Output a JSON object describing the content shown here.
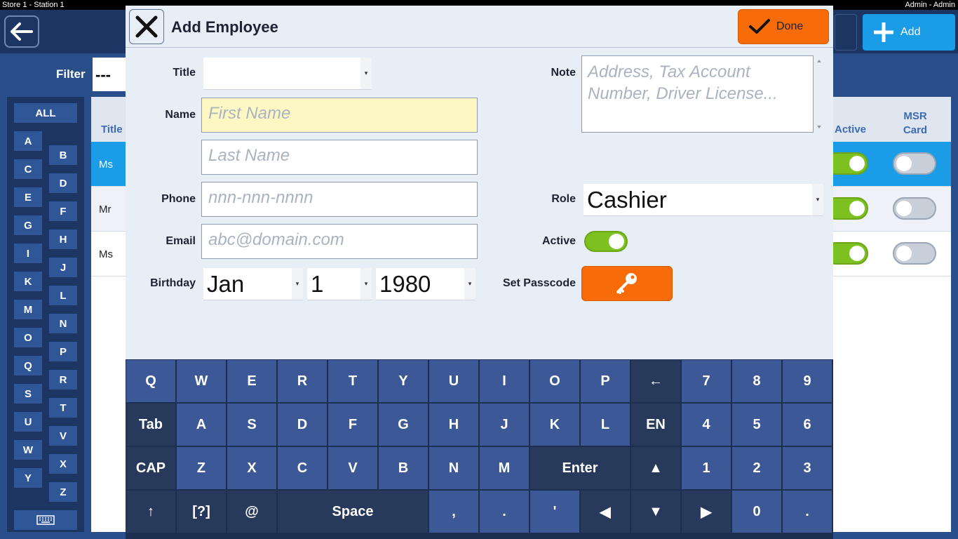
{
  "window": {
    "station": "Store 1 - Station 1",
    "user": "Admin - Admin"
  },
  "toolbar": {
    "add_label": "Add"
  },
  "filter": {
    "label": "Filter",
    "value": "---"
  },
  "alphabet": {
    "all_label": "ALL",
    "left_column": [
      "A",
      "C",
      "E",
      "G",
      "I",
      "K",
      "M",
      "O",
      "Q",
      "S",
      "U",
      "W",
      "Y"
    ],
    "right_column": [
      "B",
      "D",
      "F",
      "H",
      "J",
      "L",
      "N",
      "P",
      "R",
      "T",
      "V",
      "X",
      "Z"
    ]
  },
  "list": {
    "columns": {
      "title": "Title",
      "active": "Active",
      "msr_card": "MSR Card"
    },
    "rows": [
      {
        "title": "Ms",
        "active": true,
        "msr_card": false
      },
      {
        "title": "Mr",
        "active": true,
        "msr_card": false
      },
      {
        "title": "Ms",
        "active": true,
        "msr_card": false
      }
    ]
  },
  "dialog": {
    "title": "Add Employee",
    "done_label": "Done",
    "fields": {
      "title_label": "Title",
      "title_value": "",
      "name_label": "Name",
      "first_name_placeholder": "First Name",
      "last_name_placeholder": "Last Name",
      "phone_label": "Phone",
      "phone_placeholder": "nnn-nnn-nnnn",
      "email_label": "Email",
      "email_placeholder": "abc@domain.com",
      "birthday_label": "Birthday",
      "birthday_month": "Jan",
      "birthday_day": "1",
      "birthday_year": "1980",
      "note_label": "Note",
      "note_placeholder": "Address, Tax Account Number, Driver License...",
      "role_label": "Role",
      "role_value": "Cashier",
      "active_label": "Active",
      "active_on": true,
      "passcode_label": "Set Passcode"
    }
  },
  "keyboard": {
    "rows": [
      [
        "Q",
        "W",
        "E",
        "R",
        "T",
        "Y",
        "U",
        "I",
        "O",
        "P",
        "←",
        "7",
        "8",
        "9"
      ],
      [
        "Tab",
        "A",
        "S",
        "D",
        "F",
        "G",
        "H",
        "J",
        "K",
        "L",
        "EN",
        "4",
        "5",
        "6"
      ],
      [
        "CAP",
        "Z",
        "X",
        "C",
        "V",
        "B",
        "N",
        "M",
        "Enter",
        "▲",
        "1",
        "2",
        "3"
      ],
      [
        "↑",
        "[?]",
        "@",
        "Space",
        ",",
        ".",
        "'",
        "◀",
        "▼",
        "▶",
        "0",
        "."
      ]
    ]
  },
  "colors": {
    "accent_orange": "#f76c08",
    "accent_blue": "#1a9ce6",
    "toggle_on": "#7cc11f",
    "navy": "#1c3563"
  }
}
